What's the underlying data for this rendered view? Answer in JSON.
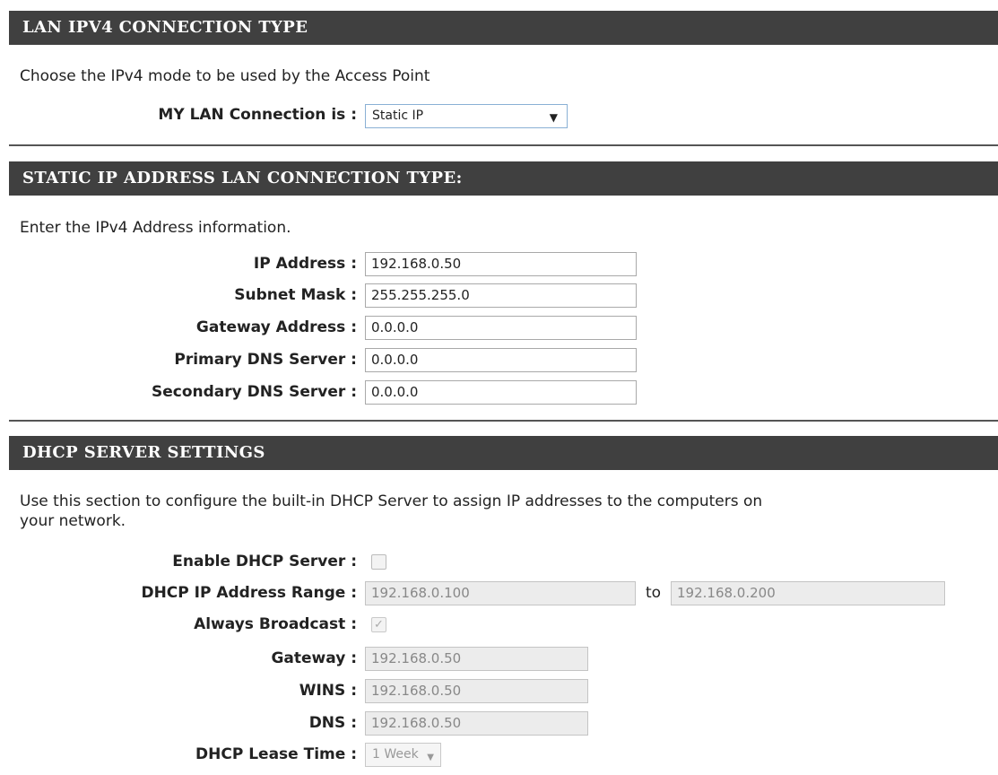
{
  "lan_type": {
    "header": "LAN IPV4 CONNECTION TYPE",
    "description": "Choose the IPv4 mode to be used by the Access Point",
    "connection_label": "MY LAN Connection is :",
    "connection_value": "Static IP"
  },
  "static_ip": {
    "header": "STATIC IP ADDRESS LAN CONNECTION TYPE:",
    "description": "Enter the IPv4 Address information.",
    "fields": [
      {
        "label": "IP Address :",
        "value": "192.168.0.50"
      },
      {
        "label": "Subnet Mask :",
        "value": "255.255.255.0"
      },
      {
        "label": "Gateway Address :",
        "value": "0.0.0.0"
      },
      {
        "label": "Primary DNS Server :",
        "value": "0.0.0.0"
      },
      {
        "label": "Secondary DNS Server :",
        "value": "0.0.0.0"
      }
    ]
  },
  "dhcp": {
    "header": "DHCP SERVER SETTINGS",
    "description_line1": "Use this section to configure the built-in DHCP Server to assign IP addresses to the computers on",
    "description_line2": "your network.",
    "enable_label": "Enable DHCP Server :",
    "enable_checked": false,
    "range_label": "DHCP IP Address Range :",
    "range_start": "192.168.0.100",
    "range_to": "to",
    "range_end": "192.168.0.200",
    "broadcast_label": "Always Broadcast :",
    "broadcast_checked": true,
    "gateway_label": "Gateway :",
    "gateway_value": "192.168.0.50",
    "wins_label": "WINS :",
    "wins_value": "192.168.0.50",
    "dns_label": "DNS :",
    "dns_value": "192.168.0.50",
    "lease_label": "DHCP Lease Time :",
    "lease_value": "1 Week"
  },
  "colors": {
    "header_bar": "#404040",
    "header_text": "#ffffff",
    "disabled_field": "#ececec"
  }
}
